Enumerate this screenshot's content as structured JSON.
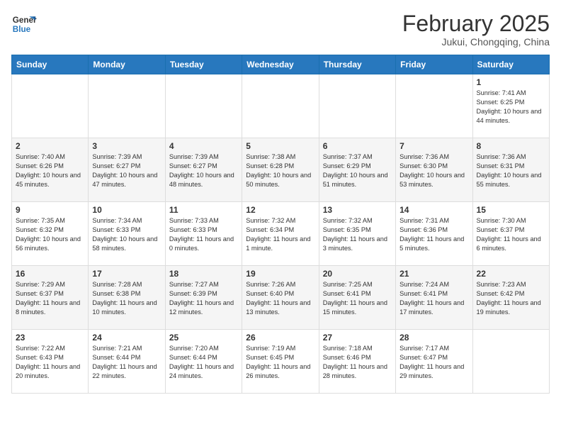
{
  "header": {
    "logo_line1": "General",
    "logo_line2": "Blue",
    "month": "February 2025",
    "location": "Jukui, Chongqing, China"
  },
  "weekdays": [
    "Sunday",
    "Monday",
    "Tuesday",
    "Wednesday",
    "Thursday",
    "Friday",
    "Saturday"
  ],
  "weeks": [
    [
      {
        "day": "",
        "info": ""
      },
      {
        "day": "",
        "info": ""
      },
      {
        "day": "",
        "info": ""
      },
      {
        "day": "",
        "info": ""
      },
      {
        "day": "",
        "info": ""
      },
      {
        "day": "",
        "info": ""
      },
      {
        "day": "1",
        "info": "Sunrise: 7:41 AM\nSunset: 6:25 PM\nDaylight: 10 hours and 44 minutes."
      }
    ],
    [
      {
        "day": "2",
        "info": "Sunrise: 7:40 AM\nSunset: 6:26 PM\nDaylight: 10 hours and 45 minutes."
      },
      {
        "day": "3",
        "info": "Sunrise: 7:39 AM\nSunset: 6:27 PM\nDaylight: 10 hours and 47 minutes."
      },
      {
        "day": "4",
        "info": "Sunrise: 7:39 AM\nSunset: 6:27 PM\nDaylight: 10 hours and 48 minutes."
      },
      {
        "day": "5",
        "info": "Sunrise: 7:38 AM\nSunset: 6:28 PM\nDaylight: 10 hours and 50 minutes."
      },
      {
        "day": "6",
        "info": "Sunrise: 7:37 AM\nSunset: 6:29 PM\nDaylight: 10 hours and 51 minutes."
      },
      {
        "day": "7",
        "info": "Sunrise: 7:36 AM\nSunset: 6:30 PM\nDaylight: 10 hours and 53 minutes."
      },
      {
        "day": "8",
        "info": "Sunrise: 7:36 AM\nSunset: 6:31 PM\nDaylight: 10 hours and 55 minutes."
      }
    ],
    [
      {
        "day": "9",
        "info": "Sunrise: 7:35 AM\nSunset: 6:32 PM\nDaylight: 10 hours and 56 minutes."
      },
      {
        "day": "10",
        "info": "Sunrise: 7:34 AM\nSunset: 6:33 PM\nDaylight: 10 hours and 58 minutes."
      },
      {
        "day": "11",
        "info": "Sunrise: 7:33 AM\nSunset: 6:33 PM\nDaylight: 11 hours and 0 minutes."
      },
      {
        "day": "12",
        "info": "Sunrise: 7:32 AM\nSunset: 6:34 PM\nDaylight: 11 hours and 1 minute."
      },
      {
        "day": "13",
        "info": "Sunrise: 7:32 AM\nSunset: 6:35 PM\nDaylight: 11 hours and 3 minutes."
      },
      {
        "day": "14",
        "info": "Sunrise: 7:31 AM\nSunset: 6:36 PM\nDaylight: 11 hours and 5 minutes."
      },
      {
        "day": "15",
        "info": "Sunrise: 7:30 AM\nSunset: 6:37 PM\nDaylight: 11 hours and 6 minutes."
      }
    ],
    [
      {
        "day": "16",
        "info": "Sunrise: 7:29 AM\nSunset: 6:37 PM\nDaylight: 11 hours and 8 minutes."
      },
      {
        "day": "17",
        "info": "Sunrise: 7:28 AM\nSunset: 6:38 PM\nDaylight: 11 hours and 10 minutes."
      },
      {
        "day": "18",
        "info": "Sunrise: 7:27 AM\nSunset: 6:39 PM\nDaylight: 11 hours and 12 minutes."
      },
      {
        "day": "19",
        "info": "Sunrise: 7:26 AM\nSunset: 6:40 PM\nDaylight: 11 hours and 13 minutes."
      },
      {
        "day": "20",
        "info": "Sunrise: 7:25 AM\nSunset: 6:41 PM\nDaylight: 11 hours and 15 minutes."
      },
      {
        "day": "21",
        "info": "Sunrise: 7:24 AM\nSunset: 6:41 PM\nDaylight: 11 hours and 17 minutes."
      },
      {
        "day": "22",
        "info": "Sunrise: 7:23 AM\nSunset: 6:42 PM\nDaylight: 11 hours and 19 minutes."
      }
    ],
    [
      {
        "day": "23",
        "info": "Sunrise: 7:22 AM\nSunset: 6:43 PM\nDaylight: 11 hours and 20 minutes."
      },
      {
        "day": "24",
        "info": "Sunrise: 7:21 AM\nSunset: 6:44 PM\nDaylight: 11 hours and 22 minutes."
      },
      {
        "day": "25",
        "info": "Sunrise: 7:20 AM\nSunset: 6:44 PM\nDaylight: 11 hours and 24 minutes."
      },
      {
        "day": "26",
        "info": "Sunrise: 7:19 AM\nSunset: 6:45 PM\nDaylight: 11 hours and 26 minutes."
      },
      {
        "day": "27",
        "info": "Sunrise: 7:18 AM\nSunset: 6:46 PM\nDaylight: 11 hours and 28 minutes."
      },
      {
        "day": "28",
        "info": "Sunrise: 7:17 AM\nSunset: 6:47 PM\nDaylight: 11 hours and 29 minutes."
      },
      {
        "day": "",
        "info": ""
      }
    ]
  ]
}
